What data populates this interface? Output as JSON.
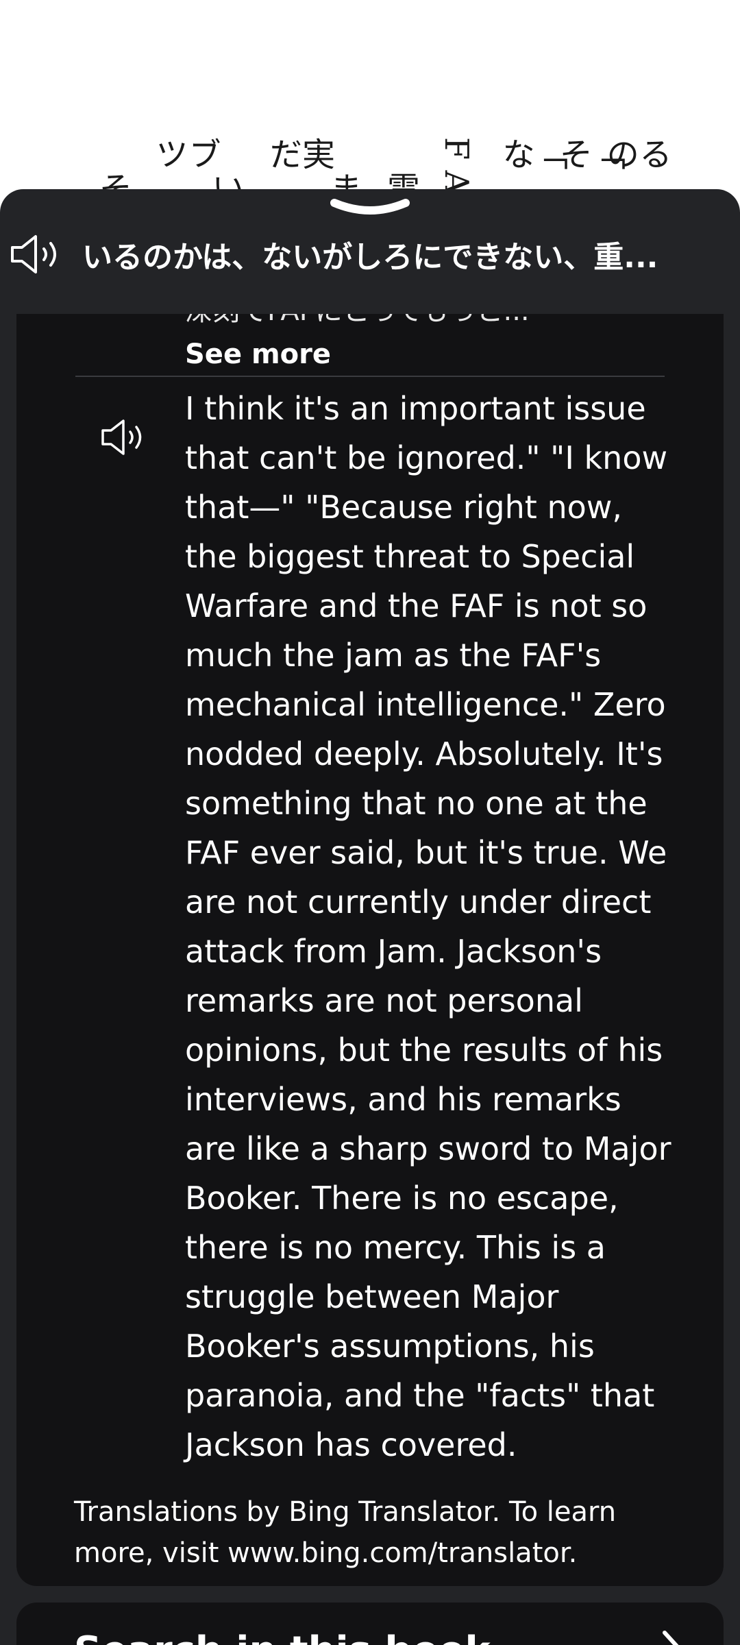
{
  "background_page": {
    "columns": [
      "る\nの",
      "「\nそ",
      "「\nな",
      "F\nA",
      "電",
      "ま",
      "実\nだ",
      "い",
      "ブ\nツ",
      "そ"
    ]
  },
  "sheet": {
    "header_text": "いるのかは、ないがしろにできない、重...",
    "cut_line": "深刻でFAFにとってもっと...",
    "see_more_label": "See more",
    "translation": "I think it's an important issue that can't be ignored.\" \"I know that—\" \"Because right now, the biggest threat to Special Warfare and the FAF is not so much the jam as the FAF's mechanical intelligence.\" Zero nodded deeply. Absolutely. It's something that no one at the FAF ever said, but it's true. We are not currently under direct attack from Jam. Jackson's remarks are not personal opinions, but the results of his interviews, and his remarks are like a sharp sword to Major Booker. There is no escape, there is no mercy. This is a struggle between Major Booker's assumptions, his paranoia, and the \"facts\" that Jackson has covered.",
    "attribution": "Translations by Bing Translator. To learn more, visit www.bing.com/translator."
  },
  "next_section": {
    "title": "Search in this book"
  },
  "colors": {
    "sheet_bg": "#232427",
    "card_bg": "#121214",
    "text": "#ffffff"
  },
  "icons": [
    "chevron-down-icon",
    "speaker-icon",
    "chevron-right-icon"
  ]
}
